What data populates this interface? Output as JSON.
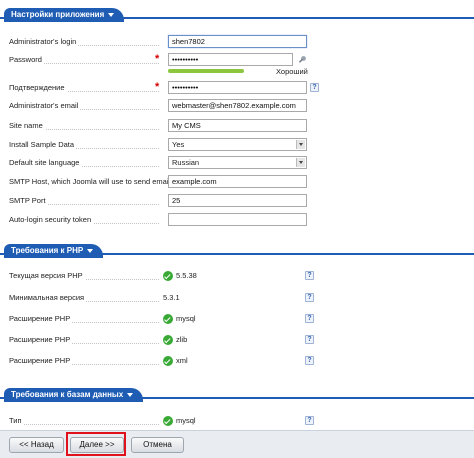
{
  "sections": {
    "app_settings": "Настройки приложения",
    "php_requirements": "Требования к PHP",
    "db_requirements": "Требования к базам данных"
  },
  "settings": {
    "admin_login_label": "Administrator's login",
    "admin_login_value": "shen7802",
    "password_label": "Password",
    "password_value": "••••••••••",
    "password_strength": "Хороший",
    "confirm_label": "Подтверждение",
    "confirm_value": "••••••••••",
    "admin_email_label": "Administrator's email",
    "admin_email_value": "webmaster@shen7802.example.com",
    "site_name_label": "Site name",
    "site_name_value": "My CMS",
    "sample_data_label": "Install Sample Data",
    "sample_data_value": "Yes",
    "language_label": "Default site language",
    "language_value": "Russian",
    "smtp_host_label": "SMTP Host, which Joomla will use to send email",
    "smtp_host_value": "example.com",
    "smtp_port_label": "SMTP Port",
    "smtp_port_value": "25",
    "autologin_label": "Auto-login security token",
    "autologin_value": ""
  },
  "php": {
    "current_label": "Текущая версия PHP",
    "current_value": "5.5.38",
    "min_label": "Минимальная версия",
    "min_value": "5.3.1",
    "ext1_label": "Расширение PHP",
    "ext1_value": "mysql",
    "ext2_label": "Расширение PHP",
    "ext2_value": "zlib",
    "ext3_label": "Расширение PHP",
    "ext3_value": "xml"
  },
  "db": {
    "type_label": "Тип",
    "type_value": "mysql"
  },
  "help_glyph": "?",
  "buttons": {
    "back": "<< Назад",
    "next": "Далее >>",
    "cancel": "Отмена"
  },
  "colors": {
    "section_blue": "#1f5db5",
    "required_red": "#d40000",
    "ok_green": "#39a935",
    "strength_green": "#8cc63f",
    "highlight_red": "#e0131d"
  }
}
